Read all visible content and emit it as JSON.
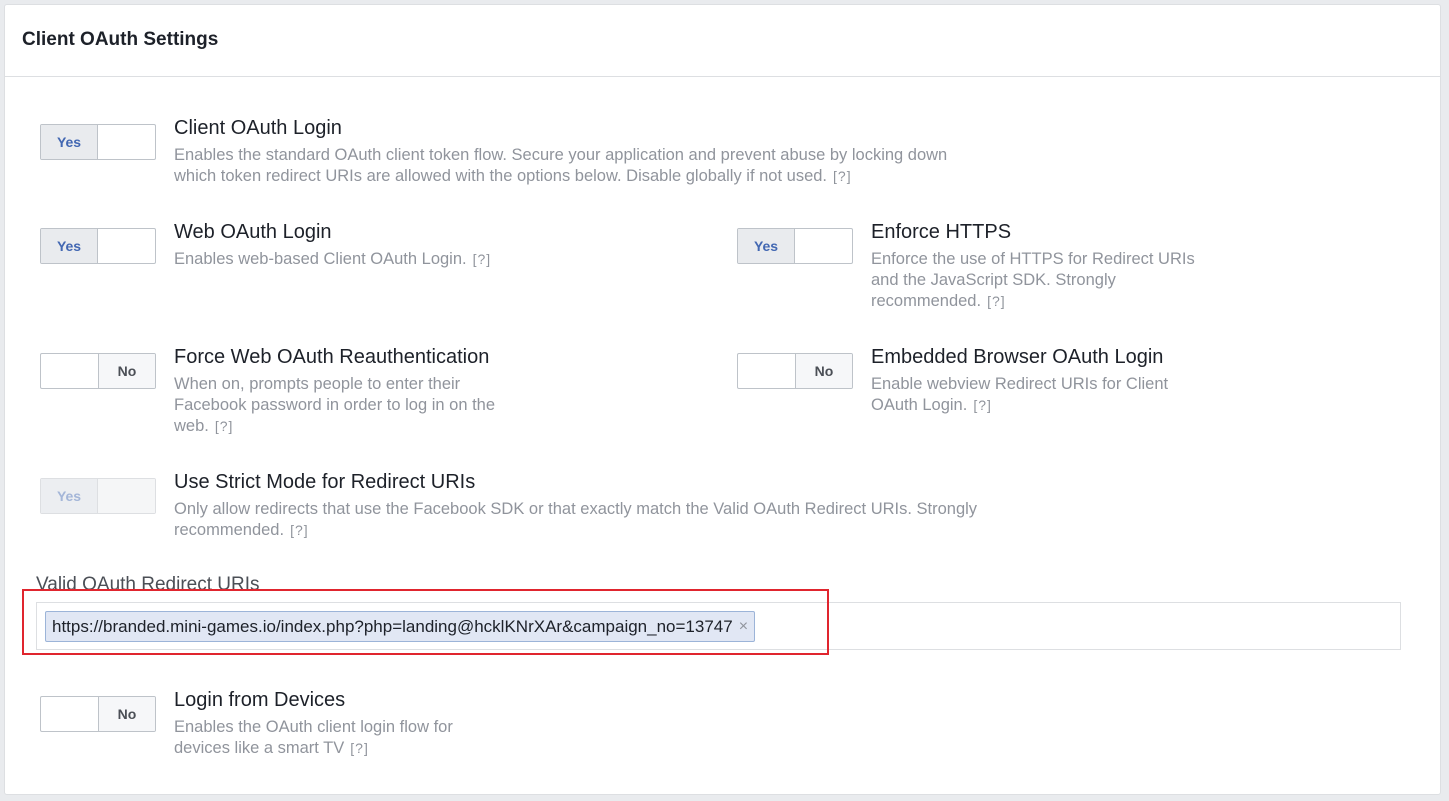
{
  "panel": {
    "title": "Client OAuth Settings"
  },
  "settings": {
    "client_oauth_login": {
      "title": "Client OAuth Login",
      "desc_line1": "Enables the standard OAuth client token flow. Secure your application and prevent abuse by locking down",
      "desc_line2": "which token redirect URIs are allowed with the options below. Disable globally if not used.",
      "toggle": "Yes"
    },
    "web_oauth_login": {
      "title": "Web OAuth Login",
      "desc_line1": "Enables web-based Client OAuth Login.",
      "toggle": "Yes"
    },
    "enforce_https": {
      "title": "Enforce HTTPS",
      "desc_line1": "Enforce the use of HTTPS for Redirect URIs",
      "desc_line2": "and the JavaScript SDK. Strongly",
      "desc_line3": "recommended.",
      "toggle": "Yes"
    },
    "force_reauth": {
      "title": "Force Web OAuth Reauthentication",
      "desc_line1": "When on, prompts people to enter their",
      "desc_line2": "Facebook password in order to log in on the",
      "desc_line3": "web.",
      "toggle": "No"
    },
    "embedded_browser": {
      "title": "Embedded Browser OAuth Login",
      "desc_line1": "Enable webview Redirect URIs for Client",
      "desc_line2": "OAuth Login.",
      "toggle": "No"
    },
    "strict_mode": {
      "title": "Use Strict Mode for Redirect URIs",
      "desc_line1": "Only allow redirects that use the Facebook SDK or that exactly match the Valid OAuth Redirect URIs. Strongly",
      "desc_line2": "recommended.",
      "toggle": "Yes"
    },
    "login_from_devices": {
      "title": "Login from Devices",
      "desc_line1": "Enables the OAuth client login flow for",
      "desc_line2": "devices like a smart TV",
      "toggle": "No"
    }
  },
  "help_label": "[?]",
  "redirect_uris": {
    "label": "Valid OAuth Redirect URIs",
    "tokens": [
      "https://branded.mini-games.io/index.php?php=landing@hcklKNrXAr&campaign_no=13747"
    ],
    "remove_glyph": "×"
  },
  "colors": {
    "accent": "#4267b2",
    "highlight": "#e0252e"
  }
}
